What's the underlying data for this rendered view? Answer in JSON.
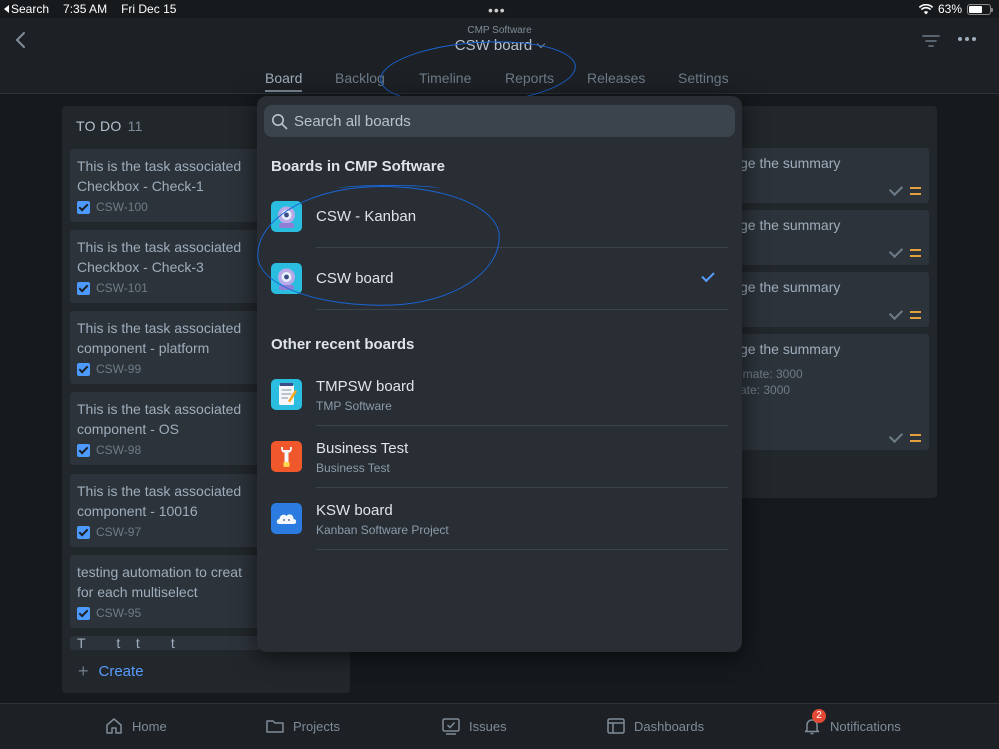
{
  "status_bar": {
    "back_app": "Search",
    "time": "7:35 AM",
    "date": "Fri Dec 15",
    "multitask_dots": "•••",
    "battery": "63%"
  },
  "header": {
    "subtitle": "CMP Software",
    "title": "CSW board",
    "tabs": [
      {
        "label": "Board",
        "active": true
      },
      {
        "label": "Backlog"
      },
      {
        "label": "Timeline"
      },
      {
        "label": "Reports"
      },
      {
        "label": "Releases"
      },
      {
        "label": "Settings"
      }
    ]
  },
  "board": {
    "todo_column": {
      "title": "TO DO",
      "count": "11",
      "cards": [
        {
          "summary": "This is the task associated\nCheckbox - Check-1",
          "key": "CSW-100"
        },
        {
          "summary": "This is the task associated\nCheckbox - Check-3",
          "key": "CSW-101"
        },
        {
          "summary": "This is the task associated\ncomponent - platform",
          "key": "CSW-99"
        },
        {
          "summary": "This is the task associated\ncomponent - OS",
          "key": "CSW-98"
        },
        {
          "summary": "This is the task associated\ncomponent - 10016",
          "key": "CSW-97"
        },
        {
          "summary": "testing automation to creat\nfor each multiselect",
          "key": "CSW-95"
        },
        {
          "summary": "T        t    t        t"
        }
      ],
      "create_label": "Create"
    },
    "right_column": {
      "cards": [
        {
          "summary": "ge the summary"
        },
        {
          "summary": "ge the summary"
        },
        {
          "summary": "ge the summary"
        },
        {
          "summary": "ge the summary",
          "meta": [
            "imate: 3000",
            "ate: 3000"
          ]
        }
      ]
    }
  },
  "popover": {
    "search_placeholder": "Search all boards",
    "section_project": "Boards in CMP Software",
    "project_boards": [
      {
        "name": "CSW - Kanban",
        "icon": "robot-avatar-icon",
        "selected": false
      },
      {
        "name": "CSW board",
        "icon": "robot-avatar-icon",
        "selected": true
      }
    ],
    "section_recent": "Other recent boards",
    "recent_boards": [
      {
        "name": "TMPSW board",
        "project": "TMP Software",
        "icon": "notepad-icon"
      },
      {
        "name": "Business Test",
        "project": "Business Test",
        "icon": "wrench-icon"
      },
      {
        "name": "KSW board",
        "project": "Kanban Software Project",
        "icon": "cloud-icon"
      }
    ]
  },
  "bottom_nav": {
    "items": [
      {
        "label": "Home",
        "icon": "home-icon"
      },
      {
        "label": "Projects",
        "icon": "folder-icon"
      },
      {
        "label": "Issues",
        "icon": "issues-icon"
      },
      {
        "label": "Dashboards",
        "icon": "dashboard-icon"
      },
      {
        "label": "Notifications",
        "icon": "bell-icon"
      }
    ],
    "notification_count": "2"
  },
  "colors": {
    "background": "#161a1d",
    "accent": "#579dff",
    "annotation": "#1a64d4",
    "priority": "#e2a03f",
    "badge": "#e34935"
  }
}
